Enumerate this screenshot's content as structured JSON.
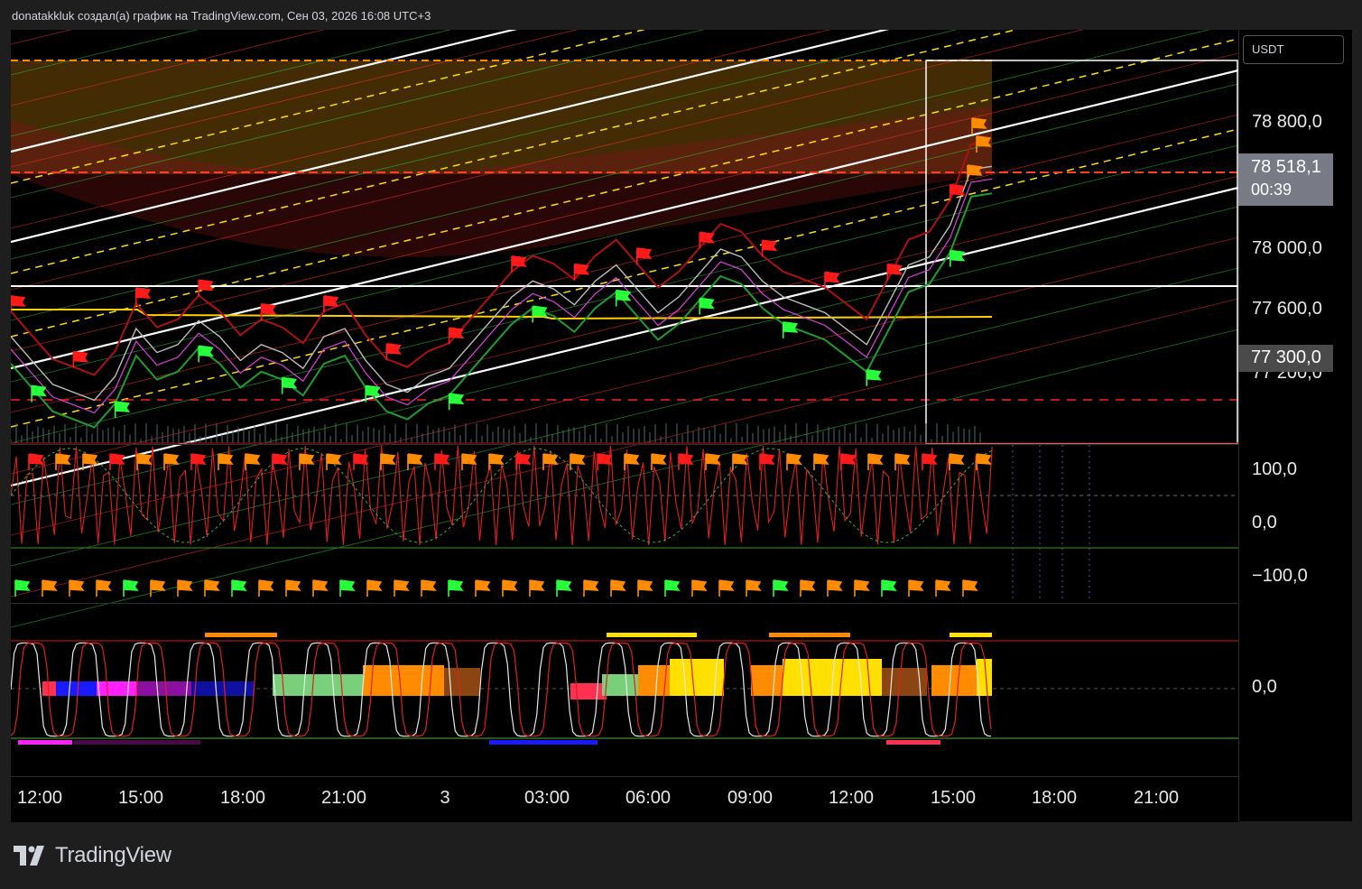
{
  "header": {
    "attribution": "donatakkluk создал(а) график на TradingView.com, Сен 03, 2026 16:08 UTC+3"
  },
  "currency": "USDT",
  "price_axis": {
    "labels": [
      "78 800,0",
      "78 000,0",
      "77 600,0",
      "77 200,0"
    ],
    "current_price": "78 518,1",
    "countdown": "00:39",
    "level_label": "77 300,0"
  },
  "oscillator1_axis": [
    "100,0",
    "0,0",
    "−100,0"
  ],
  "oscillator2_axis": [
    "0,0"
  ],
  "time_axis": [
    "12:00",
    "15:00",
    "18:00",
    "21:00",
    "3",
    "03:00",
    "06:00",
    "09:00",
    "12:00",
    "15:00",
    "18:00",
    "21:00"
  ],
  "logo": {
    "text": "TradingView"
  },
  "colors": {
    "background": "#000000",
    "frame": "#1e1e1e",
    "up": "#26ff3a",
    "down": "#ff1a1a",
    "orange": "#ff8c00",
    "yellow": "#ffe000",
    "white": "#ffffff"
  },
  "chart_data": {
    "type": "line",
    "title": "",
    "symbol_quote": "USDT",
    "x_ticks": [
      "12:00",
      "15:00",
      "18:00",
      "21:00",
      "3",
      "03:00",
      "06:00",
      "09:00",
      "12:00",
      "15:00",
      "18:00",
      "21:00"
    ],
    "ylim": [
      77000,
      79200
    ],
    "y_ticks": [
      77200,
      77600,
      78000,
      78800
    ],
    "horizontal_levels": [
      78950,
      78480,
      77715,
      77050
    ],
    "current_price": 78518.1,
    "marked_level": 77300,
    "series": [
      {
        "values": [
          77450,
          77300,
          77150,
          77100,
          77050,
          77200,
          77500,
          77350,
          77400,
          77550,
          77450,
          77300,
          77400,
          77350,
          77250,
          77450,
          77500,
          77300,
          77150,
          77100,
          77200,
          77250,
          77400,
          77550,
          77700,
          77800,
          77750,
          77650,
          77800,
          77900,
          77750,
          77600,
          77700,
          77850,
          78000,
          77950,
          77800,
          77700,
          77650,
          77600,
          77500,
          77400,
          77650,
          77900,
          77950,
          78150,
          78500,
          78520
        ]
      }
    ],
    "oscillator_ylim": [
      -100,
      100
    ],
    "oscillator_levels": [
      100,
      0,
      -100
    ]
  }
}
